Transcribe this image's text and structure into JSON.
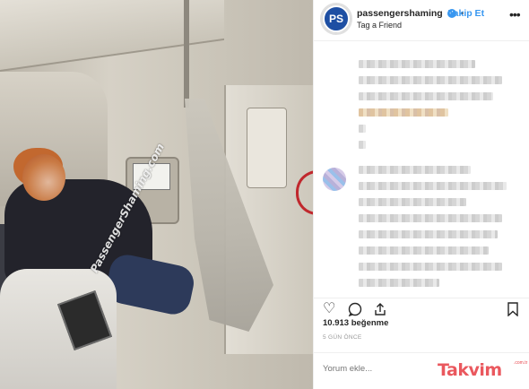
{
  "photo": {
    "watermark": "PassengerShaming.com"
  },
  "post_header": {
    "avatar_text": "PS",
    "username": "passengershaming",
    "verified_icon": "verified-badge-icon",
    "follow_label": "Takip Et",
    "follow_separator": "•",
    "subtitle": "Tag a Friend",
    "more_icon": "ellipsis-icon"
  },
  "actions": {
    "like_icon": "heart-icon",
    "comment_icon": "comment-bubble-icon",
    "share_icon": "share-icon",
    "save_icon": "bookmark-icon"
  },
  "likes": "10.913 beğenme",
  "time_ago": "5 GÜN ÖNCE",
  "comment_input": {
    "placeholder": "Yorum ekle..."
  },
  "overlay_logo": {
    "text": "Takvim",
    "suffix": ".com.tr"
  },
  "colors": {
    "link_blue": "#3897f0",
    "brand_red": "#e8474d",
    "avatar_blue": "#1e4fa3"
  }
}
